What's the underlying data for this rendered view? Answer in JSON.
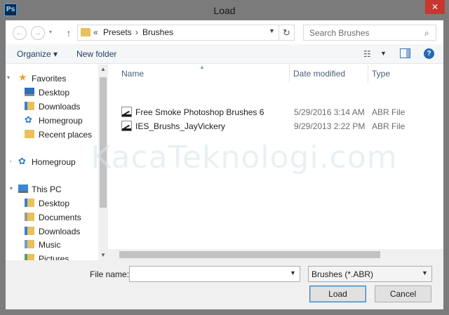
{
  "window": {
    "title": "Load",
    "app_icon_text": "Ps",
    "close_glyph": "✕"
  },
  "navigation": {
    "back_glyph": "←",
    "forward_glyph": "→",
    "up_glyph": "↑",
    "refresh_glyph": "↻"
  },
  "address_bar": {
    "overflow": "«",
    "crumbs": [
      "Presets",
      "Brushes"
    ],
    "separator": "›"
  },
  "search": {
    "placeholder": "Search Brushes",
    "icon": "search-icon"
  },
  "toolbar": {
    "organize_label": "Organize ▾",
    "new_folder_label": "New folder",
    "help_glyph": "?"
  },
  "nav_pane": {
    "items": [
      {
        "label": "Favorites",
        "icon": "star-icon"
      },
      {
        "label": "Desktop",
        "icon": "desktop-icon"
      },
      {
        "label": "Downloads",
        "icon": "downloads-folder-icon"
      },
      {
        "label": "Homegroup",
        "icon": "homegroup-icon"
      },
      {
        "label": "Recent places",
        "icon": "recent-places-icon"
      },
      {
        "label": "Homegroup",
        "icon": "homegroup-icon"
      },
      {
        "label": "This PC",
        "icon": "computer-icon"
      },
      {
        "label": "Desktop",
        "icon": "desktop-folder-icon"
      },
      {
        "label": "Documents",
        "icon": "documents-folder-icon"
      },
      {
        "label": "Downloads",
        "icon": "downloads-folder-icon"
      },
      {
        "label": "Music",
        "icon": "music-folder-icon"
      },
      {
        "label": "Pictures",
        "icon": "pictures-folder-icon"
      }
    ]
  },
  "file_list": {
    "columns": [
      "Name",
      "Date modified",
      "Type"
    ],
    "rows": [
      {
        "name": "Free Smoke Photoshop Brushes 6",
        "date": "5/29/2016 3:14 AM",
        "type": "ABR File"
      },
      {
        "name": "IES_Brushs_JayVickery",
        "date": "9/29/2013 2:22 PM",
        "type": "ABR File"
      }
    ]
  },
  "footer": {
    "file_name_label": "File name:",
    "file_name_value": "",
    "filter_value": "Brushes (*.ABR)",
    "load_label": "Load",
    "cancel_label": "Cancel"
  },
  "watermark": "KacaTeknologi.com",
  "colors": {
    "title_bar": "#7b7b7b",
    "close_button": "#c7372f",
    "link_text": "#1e3f66",
    "column_header": "#4c607a"
  }
}
